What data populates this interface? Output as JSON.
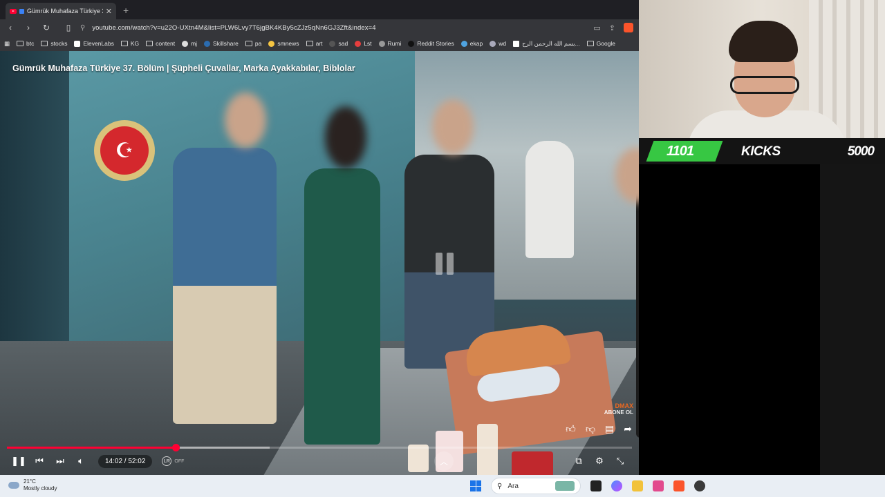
{
  "browser": {
    "tab_title": "Gümrük Muhafaza Türkiye 37",
    "new_tab": "+",
    "url": "youtube.com/watch?v=u22O-UXtn4M&list=PLW6Lvy7T6jgBK4KBy5cZJz5qNn6GJ3Zft&index=4",
    "bookmarks": [
      "btc",
      "stocks",
      "ElevenLabs",
      "KG",
      "content",
      "mj",
      "Skillshare",
      "pa",
      "smnews",
      "art",
      "sad",
      "Lst",
      "Rumi",
      "Reddit Stories",
      "ekap",
      "wd",
      "بسم الله الرحمن الرح...",
      "Google"
    ]
  },
  "video": {
    "title": "Gümrük Muhafaza Türkiye 37. Bölüm | Şüpheli Çuvallar, Marka Ayakkabılar, Biblolar",
    "current_time": "14:02",
    "duration": "52:02",
    "time_display": "14:02 / 52:02",
    "progress_fraction": 0.27,
    "buffer_fraction": 0.42,
    "lr_badge": "LR",
    "lr_state": "OFF",
    "watermark_brand": "DMAX",
    "watermark_sub": "ABONE OL"
  },
  "overlay": {
    "kicks_count": "1101",
    "kicks_label": "KICKS",
    "kicks_goal": "5000"
  },
  "taskbar": {
    "temperature": "21°C",
    "weather": "Mostly cloudy",
    "search_placeholder": "Ara"
  },
  "colors": {
    "accent": "#ff0033",
    "kicks_green": "#37c743",
    "chrome_bg": "#35363a"
  }
}
